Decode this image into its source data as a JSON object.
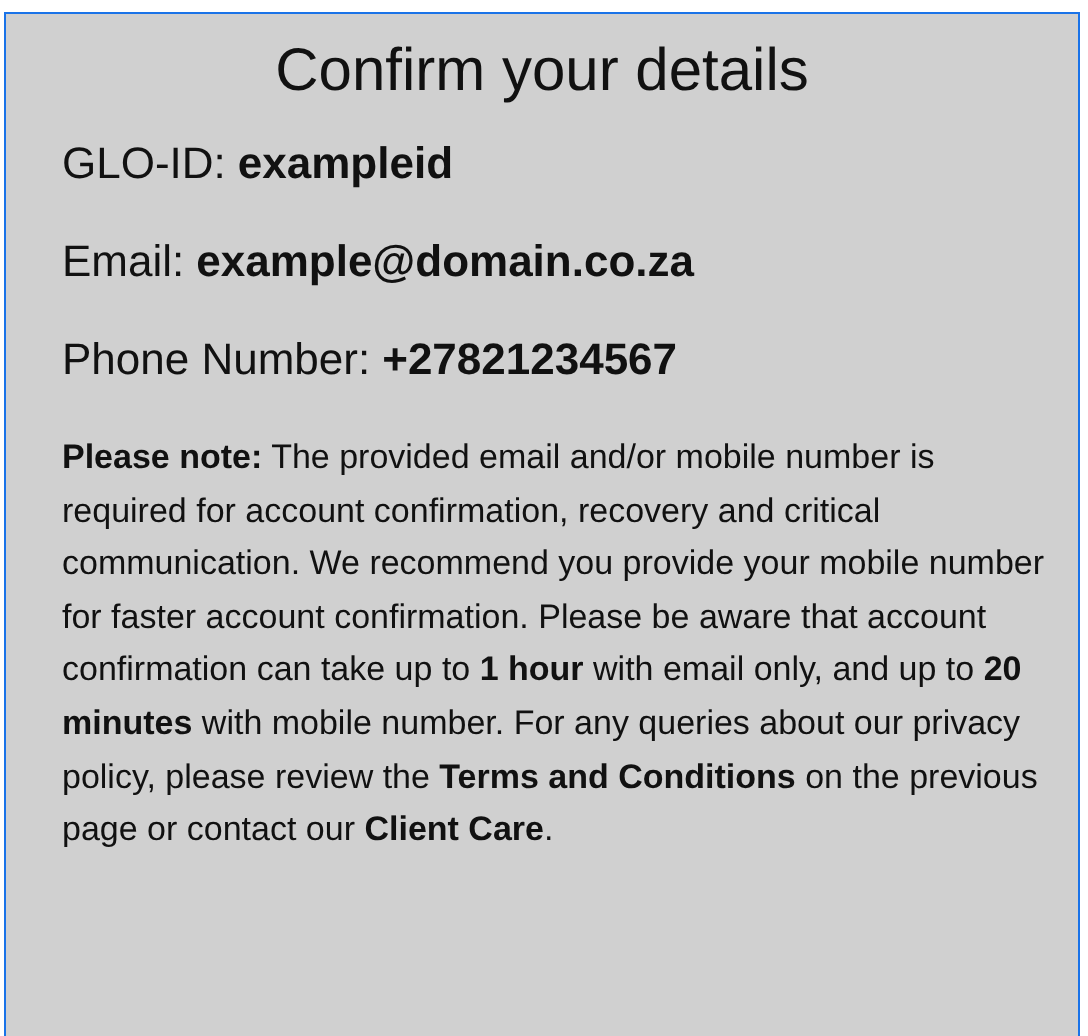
{
  "title": "Confirm your details",
  "details": [
    {
      "label": "GLO-ID:",
      "value": "exampleid"
    },
    {
      "label": "Email:",
      "value": "example@domain.co.za"
    },
    {
      "label": "Phone Number:",
      "value": "+27821234567"
    }
  ],
  "note": "**Please note:** The provided email and/or mobile number is required for account confirmation, recovery and critical communication. We recommend you provide your mobile number for faster account confirmation. Please be aware that account confirmation can take up to **1 hour** with email only, and up to **20 minutes** with mobile number. For any queries about our privacy policy, please review the **Terms and Conditions** on the previous page or contact our **Client Care**."
}
